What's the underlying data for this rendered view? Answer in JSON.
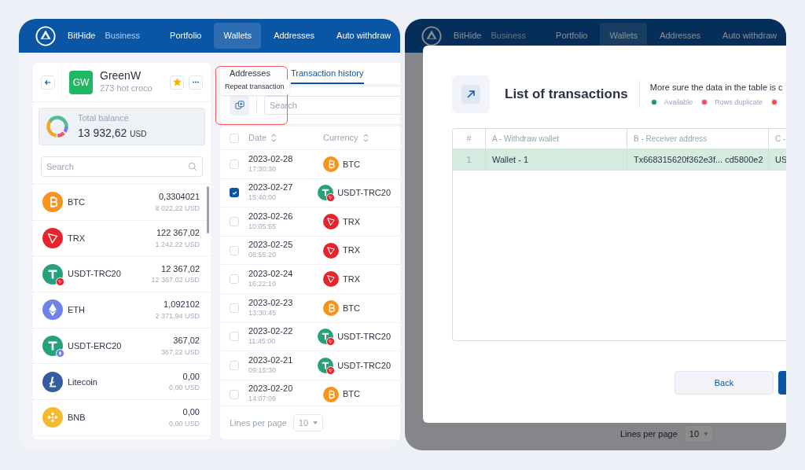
{
  "main_view": {
    "header": {
      "brand": "BitHide",
      "product": "Business",
      "nav": [
        {
          "label": "Portfolio",
          "selected": false
        },
        {
          "label": "Wallets",
          "selected": true
        },
        {
          "label": "Addresses",
          "selected": false
        },
        {
          "label": "Auto withdraw",
          "selected": false
        }
      ]
    },
    "wallet": {
      "initials": "GW",
      "name": "GreenW",
      "subtitle": "273 hot croco",
      "favorite": true,
      "balance_label": "Total balance",
      "balance": "13 932,62",
      "balance_currency": "USD",
      "search_placeholder": "Search"
    },
    "coins": [
      {
        "kind": "btc",
        "name": "BTC",
        "amount": "0,3304021",
        "usd": "8 022,22 USD"
      },
      {
        "kind": "trx",
        "name": "TRX",
        "amount": "122 367,02",
        "usd": "1 242,22 USD"
      },
      {
        "kind": "usdt",
        "badge": {
          "kind": "trx"
        },
        "name": "USDT-TRC20",
        "amount": "12 367,02",
        "usd": "12 367,02 USD"
      },
      {
        "kind": "eth",
        "name": "ETH",
        "amount": "1,092102",
        "usd": "2 371,94 USD"
      },
      {
        "kind": "usdt",
        "badge": {
          "kind": "eth"
        },
        "name": "USDT-ERC20",
        "amount": "367,02",
        "usd": "367,22 USD"
      },
      {
        "kind": "ltc",
        "name": "Litecoin",
        "amount": "0,00",
        "usd": "0,00 USD"
      },
      {
        "kind": "bnb",
        "name": "BNB",
        "amount": "0,00",
        "usd": "0,00 USD"
      }
    ],
    "tabs": [
      {
        "label": "Addresses",
        "selected": false
      },
      {
        "label": "Transaction history",
        "selected": true
      }
    ],
    "tooltip": "Repeat transaction",
    "table_search_placeholder": "Search",
    "columns": [
      "Date",
      "Currency"
    ],
    "all_checked": false,
    "rows": [
      {
        "checked": false,
        "date": "2023-02-28",
        "time": "17:30:30",
        "kind": "btc",
        "currency": "BTC"
      },
      {
        "checked": true,
        "date": "2023-02-27",
        "time": "15:40:00",
        "kind": "usdt",
        "badge": {
          "kind": "trx"
        },
        "currency": "USDT-TRC20"
      },
      {
        "checked": false,
        "date": "2023-02-26",
        "time": "10:05:55",
        "kind": "trx",
        "currency": "TRX"
      },
      {
        "checked": false,
        "date": "2023-02-25",
        "time": "08:55:20",
        "kind": "trx",
        "currency": "TRX"
      },
      {
        "checked": false,
        "date": "2023-02-24",
        "time": "16:22:10",
        "kind": "trx",
        "currency": "TRX"
      },
      {
        "checked": false,
        "date": "2023-02-23",
        "time": "13:30:45",
        "kind": "btc",
        "currency": "BTC"
      },
      {
        "checked": false,
        "date": "2023-02-22",
        "time": "11:45:00",
        "kind": "usdt",
        "badge": {
          "kind": "trx"
        },
        "currency": "USDT-TRC20"
      },
      {
        "checked": false,
        "date": "2023-02-21",
        "time": "09:15:30",
        "kind": "usdt",
        "badge": {
          "kind": "trx"
        },
        "currency": "USDT-TRC20"
      },
      {
        "checked": false,
        "date": "2023-02-20",
        "time": "14:07:09",
        "kind": "btc",
        "currency": "BTC"
      }
    ],
    "footer": {
      "label": "Lines per page",
      "value": "10"
    }
  },
  "modal_view": {
    "header": {
      "brand": "BitHide",
      "product": "Business",
      "nav": [
        {
          "label": "Portfolio",
          "selected": false
        },
        {
          "label": "Wallets",
          "selected": true
        },
        {
          "label": "Addresses",
          "selected": false
        },
        {
          "label": "Auto withdraw",
          "selected": false
        }
      ]
    },
    "footer": {
      "label": "Lines per page",
      "value": "10"
    },
    "modal": {
      "title": "List of transactions",
      "note": "More sure the data in the table is c",
      "legend": [
        {
          "label": "Available",
          "color": "#1a9a5a"
        },
        {
          "label": "Rows duplicate",
          "color": "#f04b55"
        },
        {
          "color": "#f04b55"
        }
      ],
      "columns": [
        "#",
        "A - Withdraw wallet",
        "B - Receiver address",
        "C -"
      ],
      "rows": [
        {
          "kind": "available",
          "cells": [
            "1",
            "Wallet - 1",
            "Tx668315620f362e3f... cd5800e2",
            "US"
          ]
        }
      ],
      "buttons": [
        "Back"
      ]
    }
  }
}
